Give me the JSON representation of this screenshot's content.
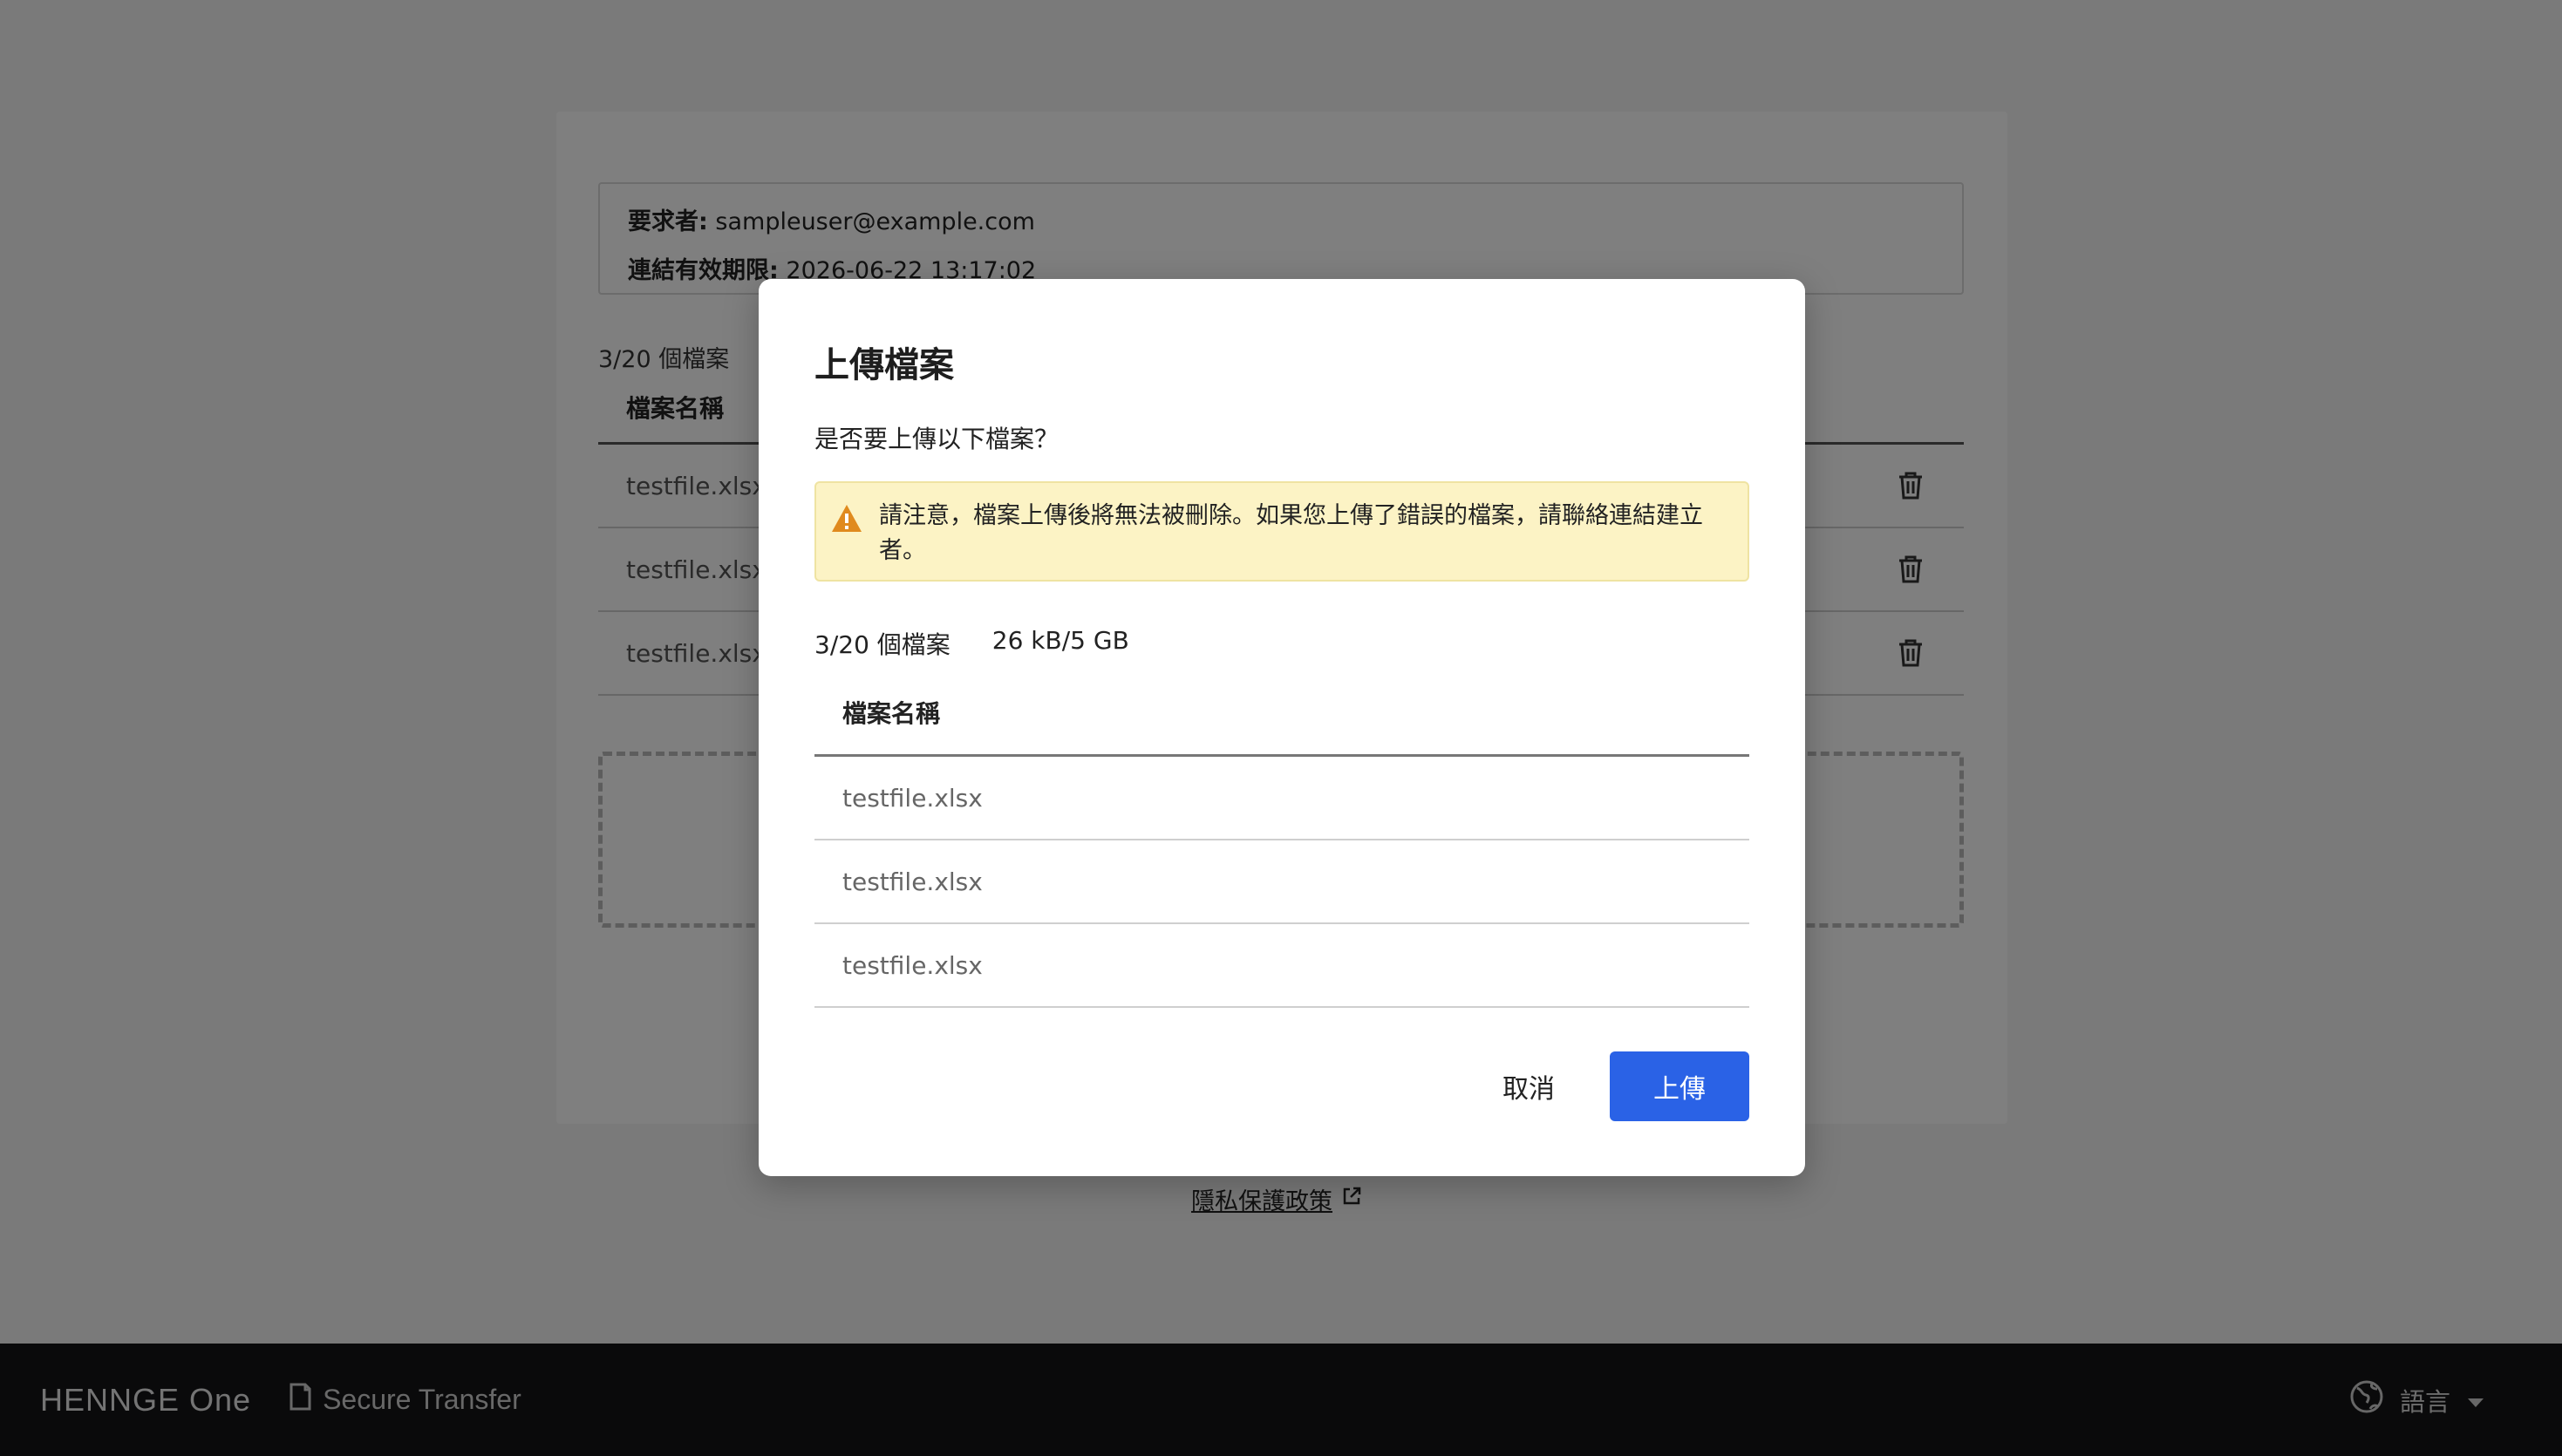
{
  "background": {
    "requester_label": "要求者:",
    "requester_value": "sampleuser@example.com",
    "expiry_label": "連結有效期限:",
    "expiry_value": "2026-06-22 13:17:02",
    "file_count": "3/20 個檔案",
    "table_header": "檔案名稱",
    "files": [
      "testfile.xlsx",
      "testfile.xlsx",
      "testfile.xlsx"
    ],
    "privacy_link": "隱私保護政策"
  },
  "footer": {
    "brand": "HENNGE One",
    "product": "Secure Transfer",
    "language": "語言"
  },
  "modal": {
    "title": "上傳檔案",
    "subtitle": "是否要上傳以下檔案？",
    "warning": "請注意，檔案上傳後將無法被刪除。如果您上傳了錯誤的檔案，請聯絡連結建立者。",
    "file_count": "3/20 個檔案",
    "size_usage": "26 kB/5 GB",
    "table_header": "檔案名稱",
    "files": [
      "testfile.xlsx",
      "testfile.xlsx",
      "testfile.xlsx"
    ],
    "cancel_label": "取消",
    "upload_label": "上傳"
  },
  "colors": {
    "primary": "#2a62e6",
    "warning_bg": "#fcf3c5",
    "warning_icon": "#e08a1e",
    "footer_bg": "#141416"
  }
}
